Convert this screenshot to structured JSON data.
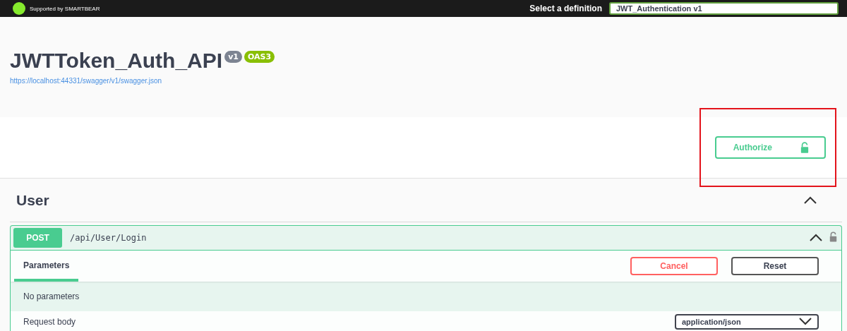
{
  "topbar": {
    "logo_caption": "Supported by SMARTBEAR",
    "definition_label": "Select a definition",
    "definition_value": "JWT_Authentication v1"
  },
  "info": {
    "title": "JWTToken_Auth_API",
    "version": "v1",
    "oas": "OAS3",
    "url": "https://localhost:44331/swagger/v1/swagger.json"
  },
  "authorize": {
    "label": "Authorize",
    "locked": false
  },
  "tag": {
    "name": "User",
    "expanded": true
  },
  "operation": {
    "method": "POST",
    "path": "/api/User/Login",
    "expanded": true,
    "locked": false,
    "tabs": [
      {
        "label": "Parameters",
        "selected": true
      }
    ],
    "buttons": [
      {
        "label": "Cancel",
        "kind": "cancel"
      },
      {
        "label": "Reset",
        "kind": "reset"
      }
    ],
    "no_params": "No parameters",
    "request_body": "Request body",
    "content_type": "application/json"
  }
}
